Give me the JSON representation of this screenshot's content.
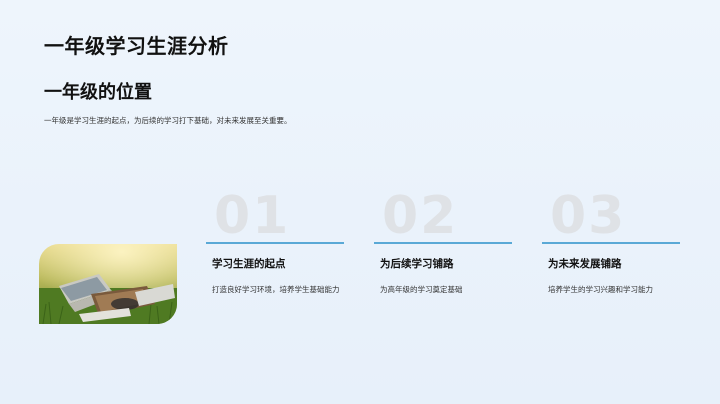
{
  "slide": {
    "title": "一年级学习生涯分析",
    "section_title": "一年级的位置",
    "subtitle": "一年级是学习生涯的起点，为后续的学习打下基础，对未来发展至关重要。"
  },
  "cards": [
    {
      "num": "01",
      "title": "学习生涯的起点",
      "desc": "打造良好学习环境，培养学生基础能力"
    },
    {
      "num": "02",
      "title": "为后续学习铺路",
      "desc": "为高年级的学习奠定基础"
    },
    {
      "num": "03",
      "title": "为未来发展铺路",
      "desc": "培养学生的学习兴趣和学习能力"
    }
  ],
  "colors": {
    "accent_line": "#5aa9d6",
    "number_fill": "#dfe2e6",
    "background": "#eaf2fb"
  }
}
